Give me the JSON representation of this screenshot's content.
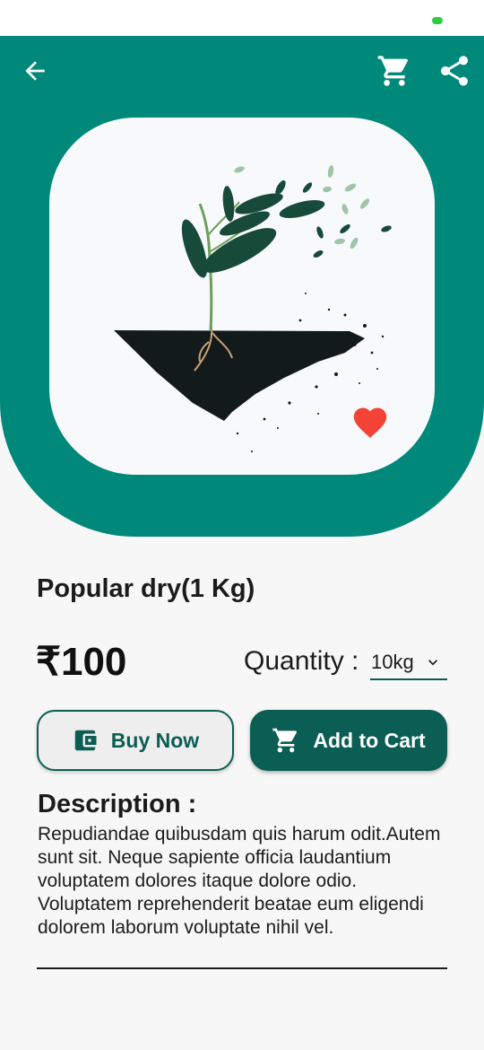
{
  "colors": {
    "primary": "#00897b",
    "dark_accent": "#0b5e54",
    "favorite": "#f44336",
    "background": "#f7f7f7"
  },
  "icons": {
    "back": "arrow-left-icon",
    "cart": "shopping-cart-icon",
    "share": "share-icon",
    "favorite": "heart-icon",
    "wallet": "wallet-icon",
    "chevron": "chevron-down-icon"
  },
  "product": {
    "title": "Popular dry(1 Kg)",
    "price": "₹100",
    "quantity_label": "Quantity :",
    "quantity_value": "10kg",
    "favorited": true
  },
  "actions": {
    "buy_now": "Buy Now",
    "add_to_cart": "Add to Cart"
  },
  "description": {
    "heading": "Description :",
    "text": "Repudiandae quibusdam quis harum odit.Autem sunt sit. Neque sapiente officia laudantium voluptatem dolores itaque dolore odio. Voluptatem reprehenderit beatae eum eligendi dolorem laborum voluptate nihil vel."
  }
}
